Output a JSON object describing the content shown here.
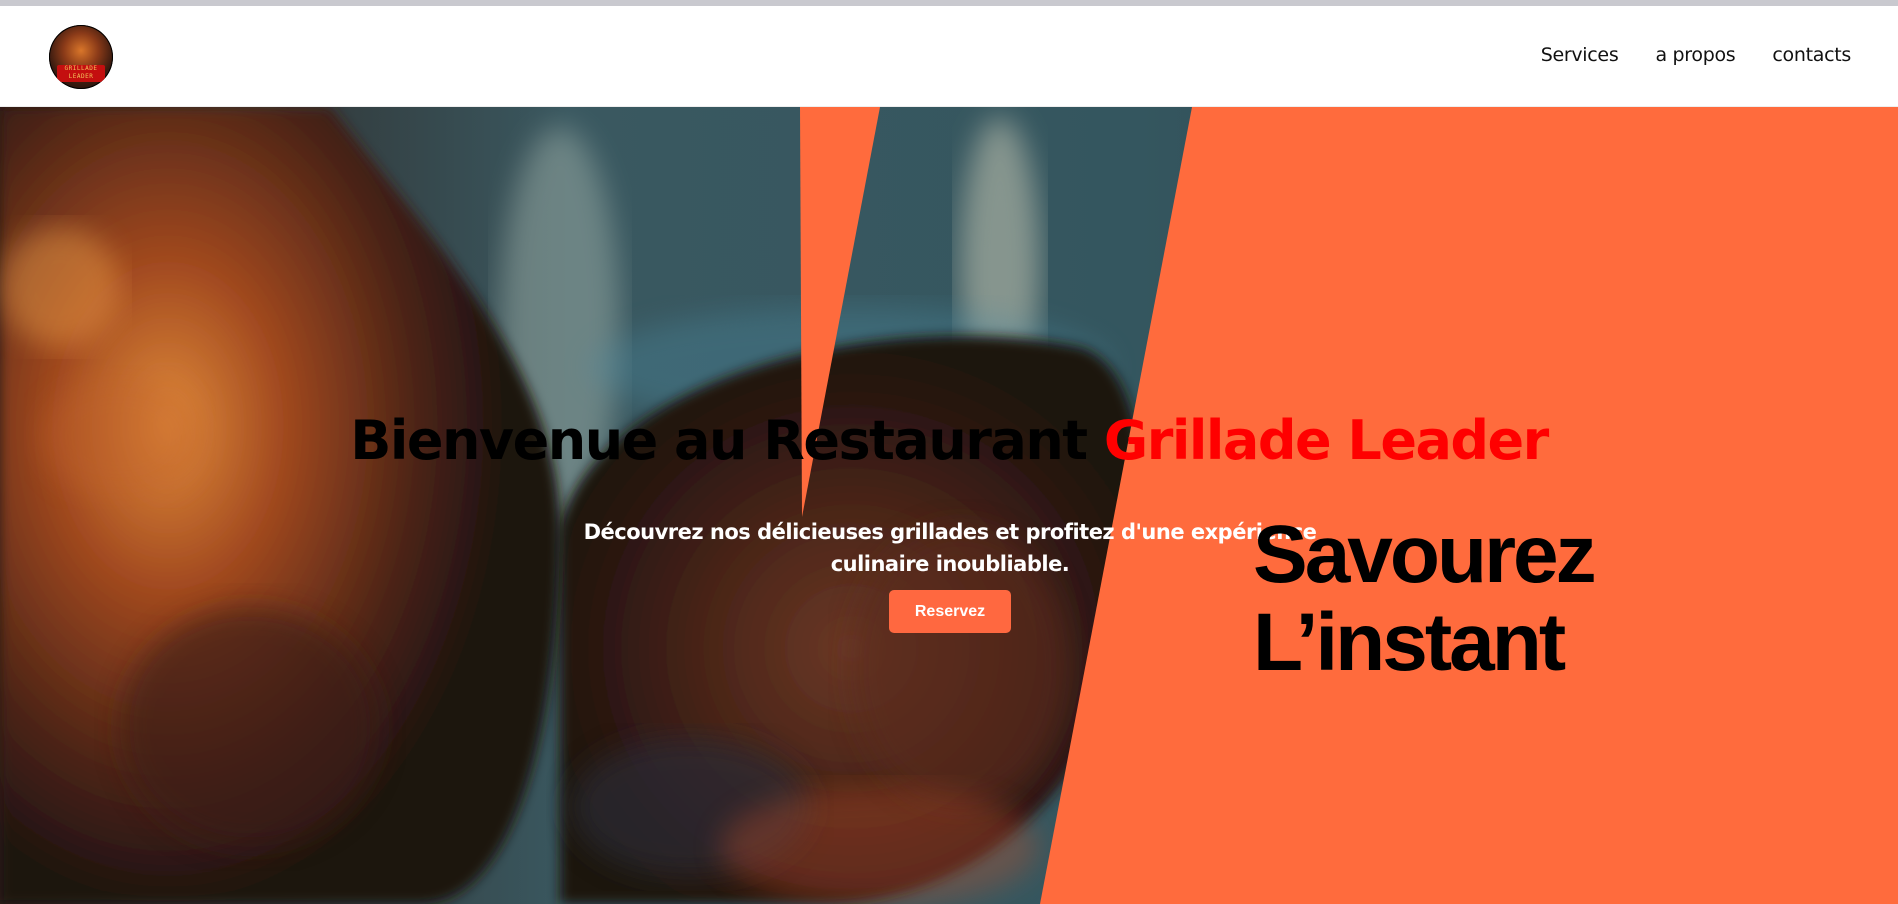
{
  "logo": {
    "alt": "Grillade Leader logo",
    "line1": "GRILLADE",
    "line2": "LEADER"
  },
  "nav": {
    "items": [
      {
        "label": "Services"
      },
      {
        "label": "a propos"
      },
      {
        "label": "contacts"
      }
    ]
  },
  "hero": {
    "title_prefix": "Bienvenue au Restaurant ",
    "title_brand": "Grillade Leader",
    "subtitle_line1": "Découvrez nos délicieuses grillades et profitez d'une expérience",
    "subtitle_line2": "culinaire inoubliable.",
    "cta_label": "Reservez",
    "slogan_line1": "Savourez",
    "slogan_line2": "L’instant"
  },
  "colors": {
    "accent_orange": "#ff6b3d",
    "brand_red": "#ff0000",
    "button_orange": "#ff6840"
  }
}
